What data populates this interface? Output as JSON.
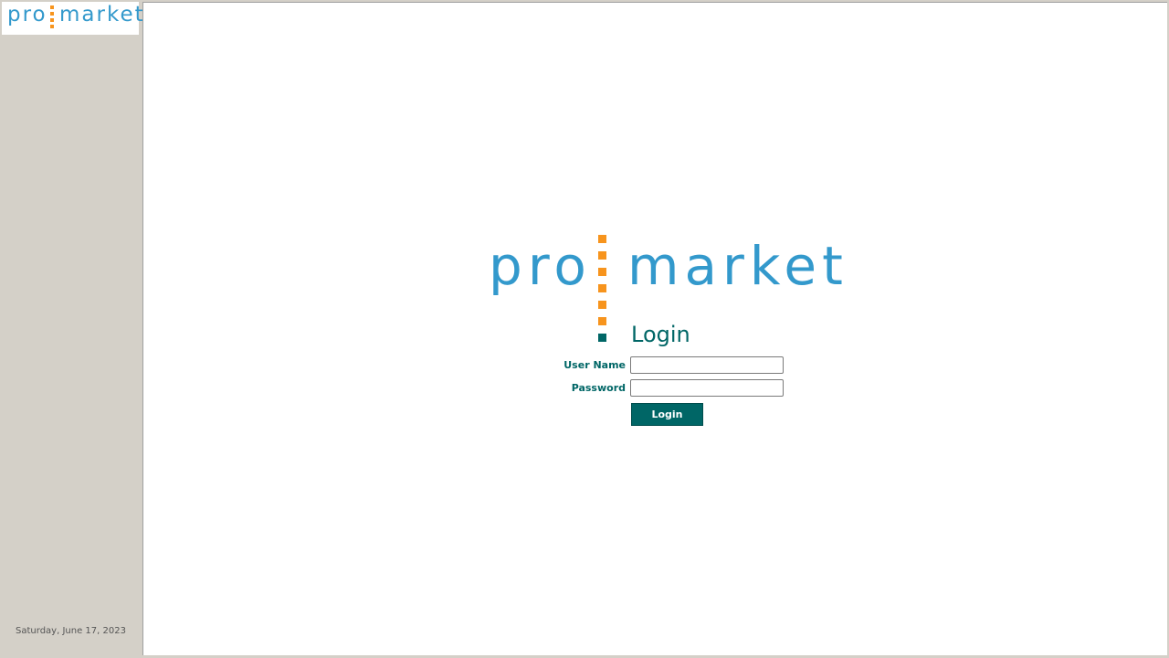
{
  "brand": {
    "part1": "pro",
    "part2": "market"
  },
  "sidebar": {
    "date": "Saturday, June 17, 2023"
  },
  "login": {
    "title": "Login",
    "username_label": "User Name",
    "username_value": "",
    "password_label": "Password",
    "password_value": "",
    "button_label": "Login"
  },
  "colors": {
    "brand_blue": "#3399cc",
    "brand_orange": "#f7941d",
    "brand_teal": "#006666",
    "sidebar_bg": "#d4d0c8"
  }
}
